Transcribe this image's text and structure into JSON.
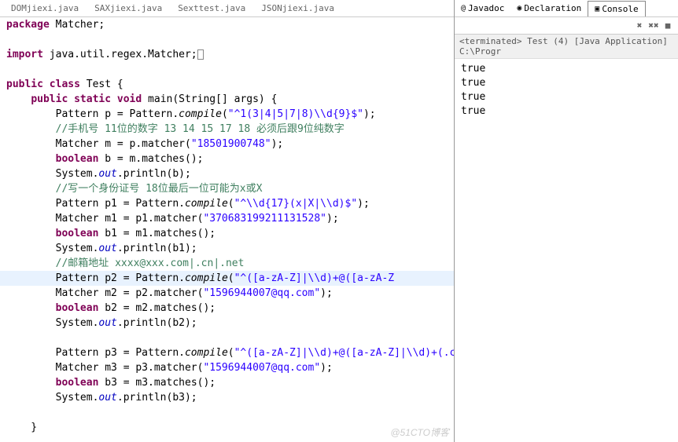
{
  "editor_tabs": [
    "DOMjiexi.java",
    "SAXjiexi.java",
    "Sexttest.java",
    "JSONjiexi.java"
  ],
  "code": {
    "pkg_kw": "package",
    "pkg_name": " Matcher;",
    "import_kw": "import",
    "import_name": " java.util.regex.Matcher;",
    "public_kw": "public",
    "class_kw": "class",
    "class_name": " Test {",
    "static_kw": "static",
    "void_kw": "void",
    "main_sig": " main(String[] args) {",
    "l1a": "        Pattern p = Pattern.",
    "compile": "compile",
    "l1b": "(",
    "l1s": "\"^1(3|4|5|7|8)\\\\d{9}$\"",
    "l1c": ");",
    "c1": "        //手机号 11位的数字 13 14 15 17 18 必须后跟9位纯数字",
    "l2": "        Matcher m = p.matcher(",
    "l2s": "\"18501900748\"",
    "l2b": ");",
    "bool_kw": "boolean",
    "l3": " b = m.matches();",
    "l4a": "        System.",
    "out": "out",
    "l4b": ".println(b);",
    "c2": "        //写一个身份证号 18位最后一位可能为x或X",
    "l5a": "        Pattern p1 = Pattern.",
    "l5s": "\"^\\\\d{17}(x|X|\\\\d)$\"",
    "l5c": ");",
    "l6": "        Matcher m1 = p1.matcher(",
    "l6s": "\"370683199211131528\"",
    "l6b": ");",
    "l7": " b1 = m1.matches();",
    "l8b": ".println(b1);",
    "c3": "        //邮箱地址 xxxx@xxx.com|.cn|.net",
    "l9a": "        Pattern p2 = Pattern.",
    "l9s": "\"^([a-zA-Z]|\\\\d)+@([a-zA-Z",
    "l9c": "",
    "l10": "        Matcher m2 = p2.matcher(",
    "l10s": "\"1596944007@qq.com\"",
    "l10b": ");",
    "l11": " b2 = m2.matches();",
    "l12b": ".println(b2);",
    "l13a": "        Pattern p3 = Pattern.",
    "l13s": "\"^([a-zA-Z]|\\\\d)+@([a-zA-Z]|\\\\d)+(.com|.cn|.net)$\"",
    "l13c": ");",
    "l14": "        Matcher m3 = p3.matcher(",
    "l14s": "\"1596944007@qq.com\"",
    "l14b": ");",
    "l15": " b3 = m3.matches();",
    "l16b": ".println(b3);",
    "close1": "    }"
  },
  "right_tabs": {
    "t1": "Javadoc",
    "t2": "Declaration",
    "t3": "Console"
  },
  "console_status": "<terminated> Test (4) [Java Application] C:\\Progr",
  "console_output": [
    "true",
    "true",
    "true",
    "true"
  ],
  "watermark": "@51CTO博客"
}
